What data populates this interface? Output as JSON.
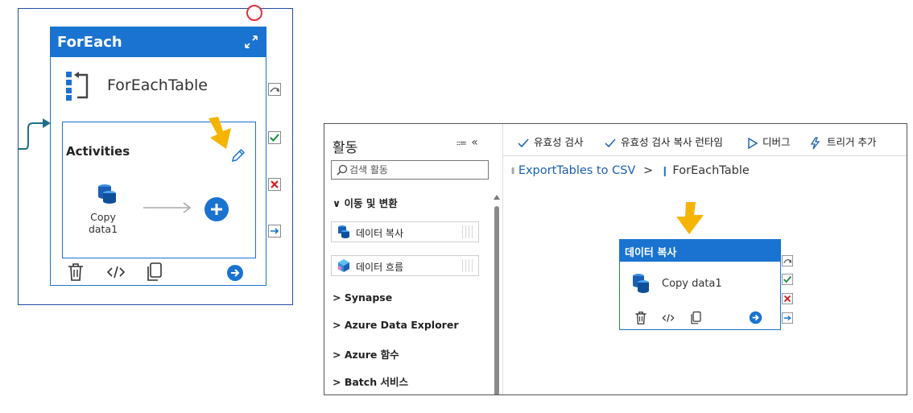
{
  "left_panel": {
    "foreach_header": "ForEach",
    "foreach_name": "ForEachTable",
    "activities_label": "Activities",
    "inner_activity": {
      "name_line1": "Copy",
      "name_line2": "data1"
    }
  },
  "right_panel": {
    "sidebar": {
      "title": "활동",
      "search_placeholder": "검색 활동",
      "categories": [
        {
          "label": "이동 및 변환",
          "expanded": true
        },
        {
          "label": "Synapse",
          "expanded": false
        },
        {
          "label": "Azure Data Explorer",
          "expanded": false
        },
        {
          "label": "Azure 함수",
          "expanded": false
        },
        {
          "label": "Batch 서비스",
          "expanded": false
        }
      ],
      "activities": [
        {
          "label": "데이터 복사",
          "icon": "copy-data-icon"
        },
        {
          "label": "데이터 흐름",
          "icon": "data-flow-icon"
        }
      ]
    },
    "toolbar": {
      "validate": "유효성 검사",
      "validate_copy_runtime": "유효성 검사 복사 런타임",
      "debug": "디버그",
      "add_trigger": "트리거 추가"
    },
    "breadcrumb": {
      "pipeline": "ExportTables to CSV",
      "separator": ">",
      "current": "ForEachTable"
    },
    "copy_activity": {
      "header": "데이터 복사",
      "name": "Copy data1"
    }
  },
  "colors": {
    "accent": "#1a73d0",
    "success": "#1a8a3a",
    "failure": "#d01c1c",
    "highlight_arrow": "#f5b400"
  }
}
